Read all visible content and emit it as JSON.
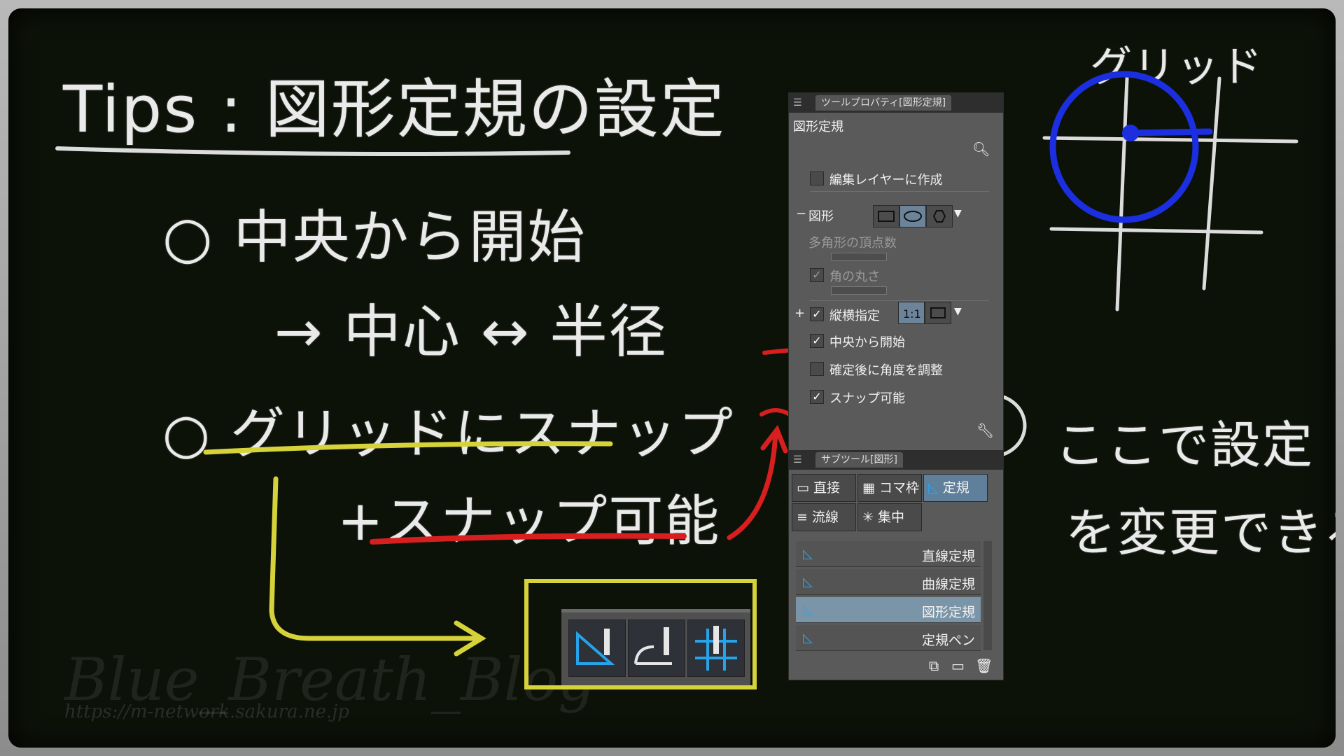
{
  "title": "Tips : 図形定規の設定",
  "bullet1": {
    "mark": "○",
    "text": "中央から開始",
    "sub": "→ 中心 ↔ 半径"
  },
  "bullet2": {
    "mark": "○",
    "text": "グリッドにスナップ",
    "sub": "+スナップ可能"
  },
  "note": {
    "line1": "ここで設定",
    "line2": "を変更できる。"
  },
  "grid_label": "グリッド",
  "watermark": {
    "name": "Blue_Breath_Blog",
    "url": "https://m-network.sakura.ne.jp"
  },
  "panel": {
    "tool_property_tab": "ツールプロパティ[図形定規]",
    "tool_name": "図形定規",
    "edit_layer": "編集レイヤーに作成",
    "shape_group": "図形",
    "polygon_vertices": "多角形の頂点数",
    "corner_round": "角の丸さ",
    "aspect": "縦横指定",
    "start_center": "中央から開始",
    "adjust_angle": "確定後に角度を調整",
    "snap": "スナップ可能",
    "subtool_tab": "サブツール[図形]",
    "subtool_buttons": [
      "直接",
      "コマ枠",
      "定規",
      "流線",
      "集中"
    ],
    "list": [
      "直線定規",
      "曲線定規",
      "図形定規",
      "定規ペン"
    ]
  },
  "colors": {
    "board": "#0d1209",
    "chalk": "#eaeaea",
    "yellow": "#d6d23a",
    "red": "#d81f1f",
    "blue": "#1b2fe0",
    "panel": "#5a5a5a"
  }
}
